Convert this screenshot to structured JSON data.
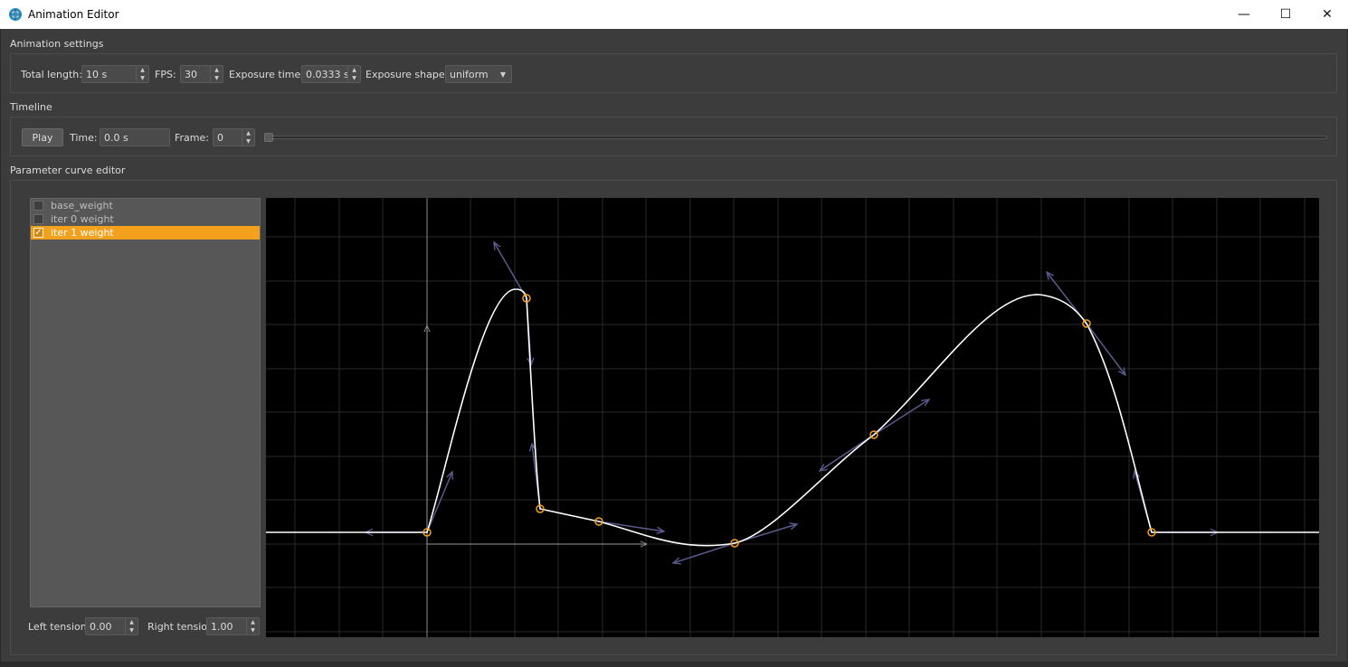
{
  "window": {
    "title": "Animation Editor",
    "minimize": "—",
    "maximize": "☐",
    "close": "✕"
  },
  "animation_settings": {
    "group_title": "Animation settings",
    "total_length_label": "Total length:",
    "total_length_value": "10 s",
    "fps_label": "FPS:",
    "fps_value": "30",
    "exposure_time_label": "Exposure time:",
    "exposure_time_value": "0.0333 s",
    "exposure_shape_label": "Exposure shape:",
    "exposure_shape_value": "uniform"
  },
  "timeline": {
    "group_title": "Timeline",
    "play_label": "Play",
    "time_label": "Time:",
    "time_value": "0.0 s",
    "frame_label": "Frame:",
    "frame_value": "0",
    "slider_position": 0
  },
  "curve_editor": {
    "group_title": "Parameter curve editor",
    "parameters": [
      {
        "label": "base_weight",
        "checked": false,
        "selected": false
      },
      {
        "label": "iter 0 weight",
        "checked": false,
        "selected": false
      },
      {
        "label": "iter 1 weight",
        "checked": true,
        "selected": true
      }
    ],
    "left_tension_label": "Left tension:",
    "left_tension_value": "0.00",
    "right_tension_label": "Right tension",
    "right_tension_value": "1.00"
  },
  "colors": {
    "selection": "#f3a01c",
    "curve": "#ffffff",
    "keyframe": "#f3a01c",
    "tangent": "#5a5a8c",
    "grid": "#2a2a2a",
    "axis": "#8a8a8a"
  },
  "icons": {
    "app": "aperture-icon",
    "spin_up": "▲",
    "spin_down": "▼",
    "dropdown": "▼",
    "check": "✓"
  }
}
